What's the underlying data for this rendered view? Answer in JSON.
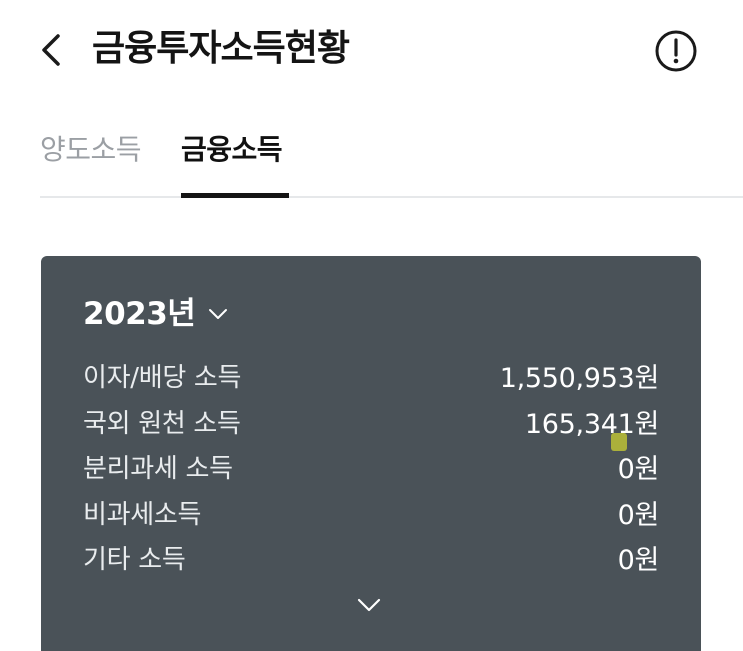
{
  "header": {
    "back_icon": "chevron-left-icon",
    "title": "금융투자소득현황",
    "info_icon": "exclamation-circle-icon"
  },
  "tabs": [
    {
      "label": "양도소득",
      "active": false
    },
    {
      "label": "금융소득",
      "active": true
    }
  ],
  "summary": {
    "year_label": "2023년",
    "year_chevron_icon": "chevron-down-icon",
    "rows": [
      {
        "label": "이자/배당 소득",
        "value": "1,550,953원"
      },
      {
        "label": "국외 원천 소득",
        "value": "165,341원"
      },
      {
        "label": "분리과세 소득",
        "value": "0원"
      },
      {
        "label": "비과세소득",
        "value": "0원"
      },
      {
        "label": "기타 소득",
        "value": "0원"
      }
    ],
    "expand_icon": "chevron-down-icon"
  },
  "colors": {
    "card_background": "#4a5258",
    "tab_inactive": "#9b9fa4",
    "tab_active": "#111111",
    "divider": "#e6e8ea",
    "highlight_marker": "#b0b53a"
  }
}
